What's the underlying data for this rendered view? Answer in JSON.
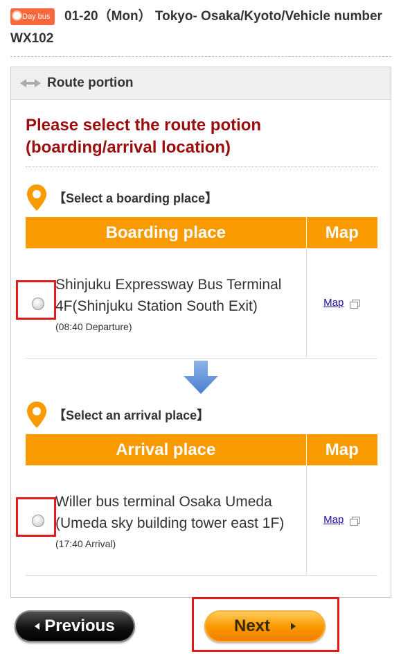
{
  "header": {
    "badge": "Day bus",
    "title": "01-20（Mon） Tokyo- Osaka/Kyoto/Vehicle number WX102"
  },
  "panel": {
    "title": "Route portion",
    "instruction": "Please select the route potion (boarding/arrival location)"
  },
  "boarding": {
    "section_label": "【Select a boarding place】",
    "col_place": "Boarding place",
    "col_map": "Map",
    "place_name": "Shinjuku Expressway Bus Terminal 4F(Shinjuku Station South Exit)",
    "time": "(08:40 Departure)",
    "map_link": "Map"
  },
  "arrival": {
    "section_label": "【Select an arrival place】",
    "col_place": "Arrival place",
    "col_map": "Map",
    "place_name": "Willer bus terminal Osaka Umeda (Umeda sky building tower east 1F)",
    "time": "(17:40 Arrival)",
    "map_link": "Map"
  },
  "buttons": {
    "previous": "Previous",
    "next": "Next"
  },
  "colors": {
    "accent_orange": "#f99a00",
    "instruction_red": "#9b0e0e",
    "badge_orange": "#f7693c",
    "highlight_red": "#e01b1b"
  }
}
